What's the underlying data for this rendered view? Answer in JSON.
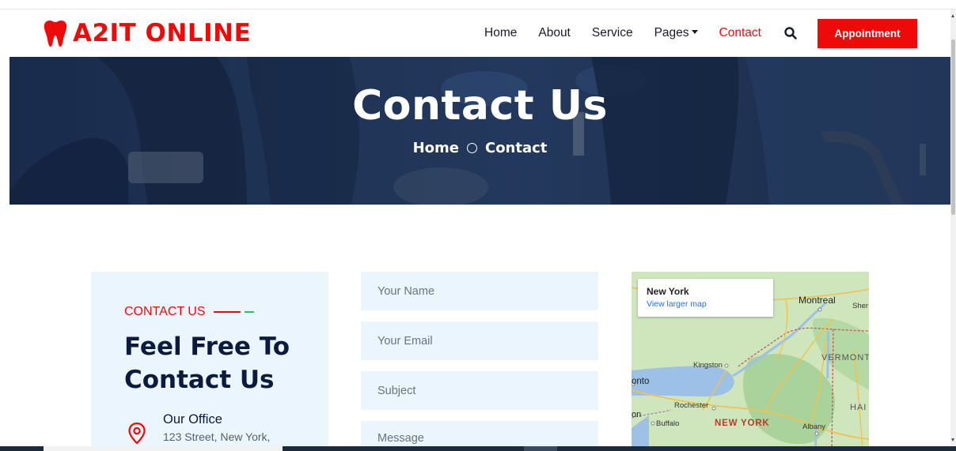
{
  "brand": {
    "name": "A2IT ONLINE",
    "icon": "tooth-icon"
  },
  "nav": {
    "links": [
      {
        "label": "Home"
      },
      {
        "label": "About"
      },
      {
        "label": "Service"
      },
      {
        "label": "Pages"
      },
      {
        "label": "Contact"
      }
    ],
    "active": "Contact",
    "search_icon": "search-icon",
    "appointment_label": "Appointment"
  },
  "hero": {
    "title": "Contact Us",
    "breadcrumb": {
      "home": "Home",
      "current": "Contact"
    }
  },
  "contact_info": {
    "subtitle": "CONTACT US",
    "heading": "Feel Free To Contact Us",
    "office": {
      "title": "Our Office",
      "address": "123 Street, New York,",
      "icon": "map-pin-icon"
    }
  },
  "form": {
    "name_placeholder": "Your Name",
    "email_placeholder": "Your Email",
    "subject_placeholder": "Subject",
    "message_placeholder": "Message"
  },
  "map": {
    "place": "New York",
    "larger_map_link": "View larger map",
    "labels": {
      "montreal": "Montreal",
      "sherbrooke": "Sher",
      "vermont": "VERMONT",
      "kingston": "Kingston",
      "toronto": "onto",
      "rochester": "Rochester",
      "buffalo": "Buffalo",
      "new_york": "NEW YORK",
      "albany": "Albany",
      "hampshire": "HAI",
      "on": "on"
    }
  },
  "colors": {
    "brand_red": "#ef0a0a",
    "navy": "#0b1b3f",
    "light_blue_bg": "#eaf5fd",
    "accent_green": "#22c55e"
  }
}
